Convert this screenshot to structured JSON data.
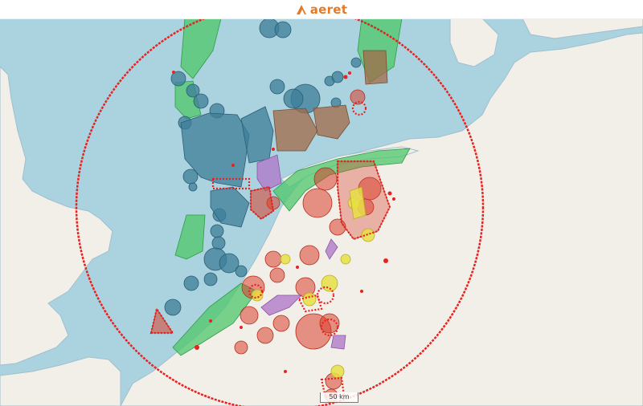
{
  "header": {
    "brand_name": "aeret",
    "brand_color": "#e07b2a"
  },
  "map": {
    "scale_label": "50 km",
    "range_circle_color": "#e8221f",
    "colors": {
      "sea": "#aad3df",
      "land": "#f2efe9",
      "zone_blue": "#3e7d98",
      "zone_green": "#4fc76a",
      "zone_red": "#d9402b",
      "zone_yellow": "#e8df45",
      "zone_purple": "#b07ac8",
      "zone_brown": "#a36a48"
    }
  }
}
